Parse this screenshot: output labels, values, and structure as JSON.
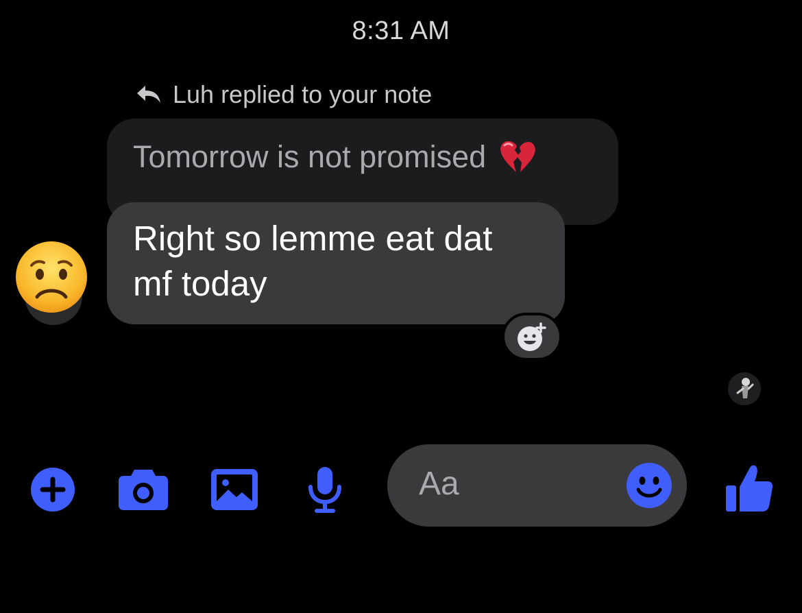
{
  "status": {
    "time": "8:31 AM"
  },
  "thread": {
    "reply_header": "Luh replied to your note",
    "note_text": "Tomorrow is not promised",
    "note_emoji": "broken-heart-icon",
    "message_line1": "Right so lemme eat dat",
    "message_line2": "mf today",
    "sender_reaction_emoji": "worried-face-icon",
    "react_button_icon": "add-reaction-icon",
    "seen_indicator": "read-receipt-avatar"
  },
  "composer": {
    "placeholder": "Aa",
    "actions": [
      "plus-icon",
      "camera-icon",
      "gallery-icon",
      "microphone-icon"
    ],
    "emoji_button": "smiley-icon",
    "like_button": "thumbs-up-icon"
  },
  "colors": {
    "accent": "#3f5efb",
    "background": "#000000",
    "bubble_incoming": "#3a3a3c",
    "bubble_note": "#1c1c1e"
  }
}
